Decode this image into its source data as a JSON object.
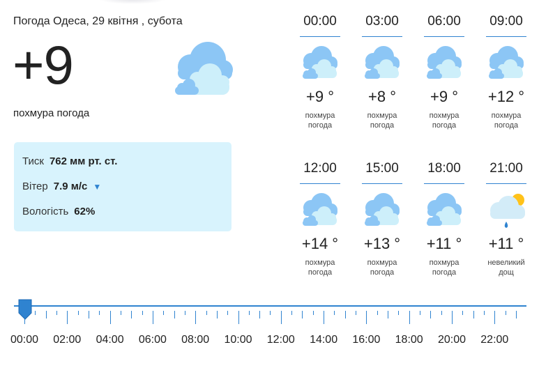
{
  "header": {
    "title": "Погода Одеса, 29 квітня , субота"
  },
  "current": {
    "temperature": "+9",
    "summary": "похмура погода",
    "icon": "cloudy-icon"
  },
  "details": {
    "pressure_label": "Тиск",
    "pressure_value": "762 мм рт. ст.",
    "wind_label": "Вітер",
    "wind_value": "7.9 м/с",
    "wind_arrow": "▼",
    "humidity_label": "Вологість",
    "humidity_value": "62%"
  },
  "hourly": [
    {
      "time": "00:00",
      "temp": "+9 °",
      "desc_line1": "похмура",
      "desc_line2": "погода",
      "icon": "cloudy-icon"
    },
    {
      "time": "03:00",
      "temp": "+8 °",
      "desc_line1": "похмура",
      "desc_line2": "погода",
      "icon": "cloudy-icon"
    },
    {
      "time": "06:00",
      "temp": "+9 °",
      "desc_line1": "похмура",
      "desc_line2": "погода",
      "icon": "cloudy-icon"
    },
    {
      "time": "09:00",
      "temp": "+12 °",
      "desc_line1": "похмура",
      "desc_line2": "погода",
      "icon": "cloudy-icon"
    },
    {
      "time": "12:00",
      "temp": "+14 °",
      "desc_line1": "похмура",
      "desc_line2": "погода",
      "icon": "cloudy-icon"
    },
    {
      "time": "15:00",
      "temp": "+13 °",
      "desc_line1": "похмура",
      "desc_line2": "погода",
      "icon": "cloudy-icon"
    },
    {
      "time": "18:00",
      "temp": "+11 °",
      "desc_line1": "похмура",
      "desc_line2": "погода",
      "icon": "cloudy-icon"
    },
    {
      "time": "21:00",
      "temp": "+11 °",
      "desc_line1": "невеликий",
      "desc_line2": "дощ",
      "icon": "light-rain-icon"
    }
  ],
  "timeline": {
    "labels": [
      "00:00",
      "02:00",
      "04:00",
      "06:00",
      "08:00",
      "10:00",
      "12:00",
      "14:00",
      "16:00",
      "18:00",
      "20:00",
      "22:00"
    ],
    "selected": "00:00"
  },
  "colors": {
    "accent": "#2f83d0",
    "panel": "#d8f3fd",
    "cloud_dark": "#8cc6f5",
    "cloud_light": "#cdeffa",
    "sun": "#ffc21a"
  }
}
